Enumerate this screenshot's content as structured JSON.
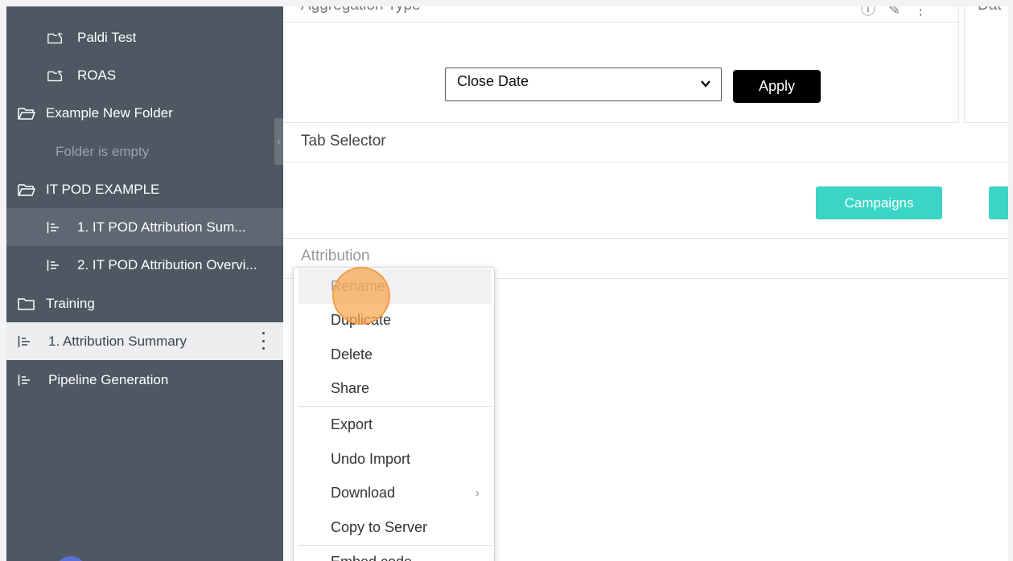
{
  "sidebar": {
    "items": [
      {
        "label": "Paldi Test",
        "icon": "dashboard-folder-icon"
      },
      {
        "label": "ROAS",
        "icon": "dashboard-folder-icon"
      },
      {
        "label": "Example New Folder",
        "icon": "folder-open-icon"
      },
      {
        "label": "Folder is empty"
      },
      {
        "label": "IT POD EXAMPLE",
        "icon": "folder-open-icon"
      },
      {
        "label": "1. IT POD Attribution Sum...",
        "icon": "report-icon"
      },
      {
        "label": "2. IT POD Attribution Overvi...",
        "icon": "report-icon"
      },
      {
        "label": "Training",
        "icon": "folder-icon"
      },
      {
        "label": "1. Attribution Summary",
        "icon": "report-icon"
      },
      {
        "label": "Pipeline Generation",
        "icon": "report-icon"
      }
    ]
  },
  "main": {
    "top_panel_title": "Aggregation Type",
    "right_stub_title": "Dat",
    "select_value": "Close Date",
    "apply_label": "Apply",
    "tab_selector_title": "Tab Selector",
    "campaigns_label": "Campaigns",
    "attribution_title": "Attribution"
  },
  "context_menu": {
    "items": [
      "Rename",
      "Duplicate",
      "Delete",
      "Share",
      "Export",
      "Undo Import",
      "Download",
      "Copy to Server",
      "Embed code"
    ]
  },
  "colors": {
    "sidebar_bg": "#4e5863",
    "accent_teal": "#3ad5c6",
    "apply_bg": "#000000",
    "click_indicator": "#f8a64e"
  }
}
